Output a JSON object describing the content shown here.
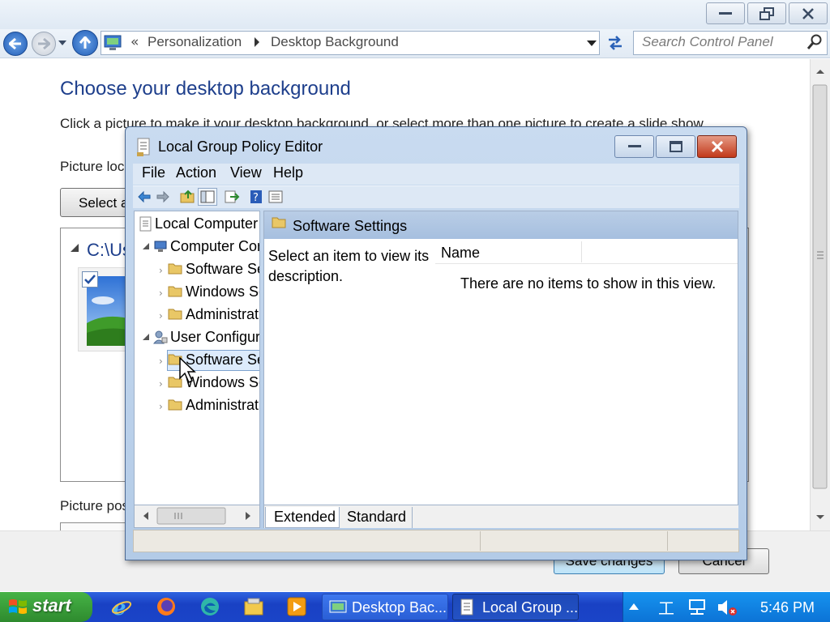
{
  "control_panel": {
    "breadcrumb": {
      "separator": "«",
      "items": [
        "Personalization",
        "Desktop Background"
      ]
    },
    "search_placeholder": "Search Control Panel",
    "heading": "Choose your desktop background",
    "description": "Click a picture to make it your desktop background, or select more than one picture to create a slide show.",
    "picture_location_label": "Picture location:",
    "select_button": "Select all",
    "folder_path": "C:\\Users",
    "picture_position_label": "Picture position:",
    "save_button": "Save changes",
    "cancel_button": "Cancel"
  },
  "gpe": {
    "title": "Local Group Policy Editor",
    "menu": [
      "File",
      "Action",
      "View",
      "Help"
    ],
    "tree": {
      "root": "Local Computer Policy",
      "computer": "Computer Configuration",
      "computer_children": [
        "Software Settings",
        "Windows Settings",
        "Administrative Templates"
      ],
      "user": "User Configuration",
      "user_children": [
        "Software Settings",
        "Windows Settings",
        "Administrative Templates"
      ],
      "selected": "User Configuration > Software Settings"
    },
    "right_header": "Software Settings",
    "description_prompt": "Select an item to view its description.",
    "column_name": "Name",
    "empty_message": "There are no items to show in this view.",
    "tabs": [
      "Extended",
      "Standard"
    ],
    "active_tab": "Extended"
  },
  "taskbar": {
    "start_label": "start",
    "tasks": [
      "Desktop Bac...",
      "Local Group ..."
    ],
    "clock": "5:46 PM"
  },
  "colors": {
    "heading_blue": "#1e3f8c",
    "taskbar_blue": "#2a5fd6",
    "start_green": "#3a9a3a"
  }
}
